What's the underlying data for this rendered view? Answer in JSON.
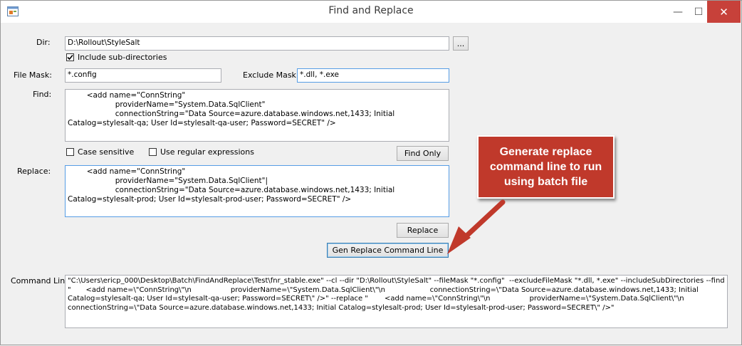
{
  "window": {
    "title": "Find and Replace",
    "minimize_glyph": "—",
    "maximize_glyph": "☐",
    "close_glyph": "✕"
  },
  "form": {
    "dir_label": "Dir:",
    "dir_value": "D:\\Rollout\\StyleSalt",
    "browse_label": "...",
    "include_subdirs_label": "Include sub-directories",
    "include_subdirs_checked": true,
    "file_mask_label": "File Mask:",
    "file_mask_value": "*.config",
    "exclude_mask_label": "Exclude Mask:",
    "exclude_mask_value": "*.dll, *.exe",
    "find_label": "Find:",
    "find_value": "\t\t<add name=\"ConnString\"\n\t\t\t\t\tproviderName=\"System.Data.SqlClient\"\n\t\t\t\t\tconnectionString=\"Data Source=azure.database.windows.net,1433; Initial Catalog=stylesalt-qa; User Id=stylesalt-qa-user; Password=SECRET\" />",
    "case_sensitive_label": "Case sensitive",
    "case_sensitive_checked": false,
    "regex_label": "Use regular expressions",
    "regex_checked": false,
    "find_only_label": "Find Only",
    "replace_label": "Replace:",
    "replace_value": "\t\t<add name=\"ConnString\"\n\t\t\t\t\tproviderName=\"System.Data.SqlClient\"|\n\t\t\t\t\tconnectionString=\"Data Source=azure.database.windows.net,1433; Initial Catalog=stylesalt-prod; User Id=stylesalt-prod-user; Password=SECRET\" />",
    "replace_button_label": "Replace",
    "gen_button_label": "Gen Replace Command Line",
    "command_line_label": "Command Line:",
    "command_line_value": "\"C:\\Users\\ericp_000\\Desktop\\Batch\\FindAndReplace\\Test\\fnr_stable.exe\" --cl --dir \"D:\\Rollout\\StyleSalt\" --fileMask \"*.config\"  --excludeFileMask \"*.dll, *.exe\" --includeSubDirectories --find \"\t\t<add name=\\\"ConnString\\\"\\n\t\t\t\t\tproviderName=\\\"System.Data.SqlClient\\\"\\n\t\t\t\t\tconnectionString=\\\"Data Source=azure.database.windows.net,1433; Initial Catalog=stylesalt-qa; User Id=stylesalt-qa-user; Password=SECRET\\\" />\" --replace \"\t\t<add name=\\\"ConnString\\\"\\n\t\t\t\t\tproviderName=\\\"System.Data.SqlClient\\\"\\n\t\t\t\t\tconnectionString=\\\"Data Source=azure.database.windows.net,1433; Initial Catalog=stylesalt-prod; User Id=stylesalt-prod-user; Password=SECRET\\\" />\""
  },
  "callout": {
    "text": "Generate replace command line to run using batch file",
    "color": "#c0392b"
  },
  "icons": {
    "app": "app-window-icon",
    "arrow": "callout-arrow-icon"
  }
}
